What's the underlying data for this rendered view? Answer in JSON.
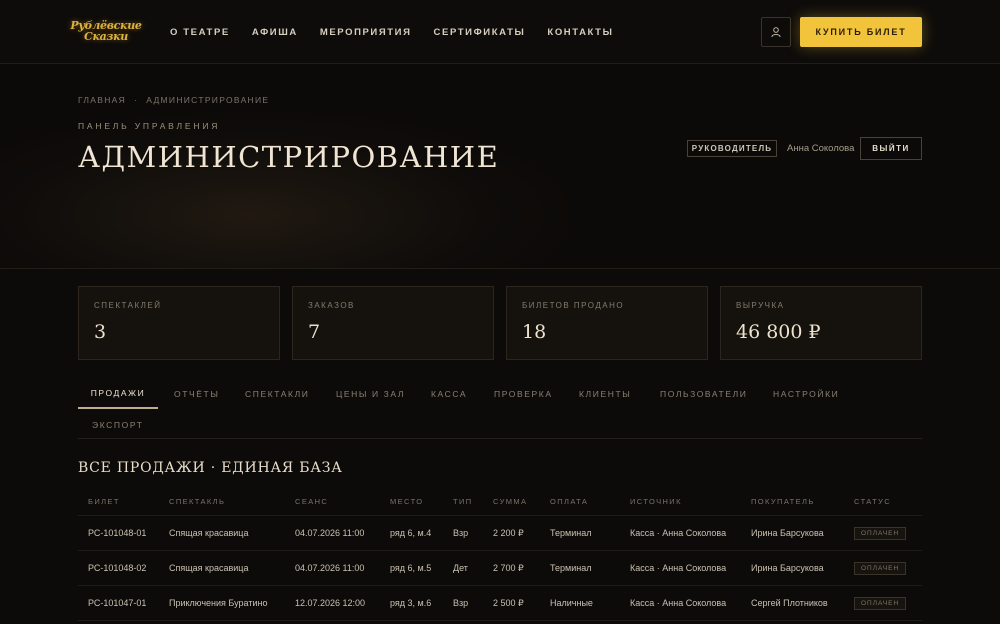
{
  "header": {
    "logo_line1": "Рублёвские",
    "logo_line2": "Сказки",
    "nav": [
      "О ТЕАТРЕ",
      "АФИША",
      "МЕРОПРИЯТИЯ",
      "СЕРТИФИКАТЫ",
      "КОНТАКТЫ"
    ],
    "buy_label": "КУПИТЬ БИЛЕТ"
  },
  "hero": {
    "breadcrumb": [
      "ГЛАВНАЯ",
      "·",
      "АДМИНИСТРИРОВАНИЕ"
    ],
    "eyebrow": "ПАНЕЛЬ УПРАВЛЕНИЯ",
    "title": "АДМИНИСТРИРОВАНИЕ",
    "role": "РУКОВОДИТЕЛЬ",
    "user_name": "Анна Соколова",
    "logout_label": "ВЫЙТИ"
  },
  "stats": [
    {
      "label": "СПЕКТАКЛЕЙ",
      "value": "3"
    },
    {
      "label": "ЗАКАЗОВ",
      "value": "7"
    },
    {
      "label": "БИЛЕТОВ ПРОДАНО",
      "value": "18"
    },
    {
      "label": "ВЫРУЧКА",
      "value": "46 800 ₽"
    }
  ],
  "tabs": [
    "ПРОДАЖИ",
    "ОТЧЁТЫ",
    "СПЕКТАКЛИ",
    "ЦЕНЫ И ЗАЛ",
    "КАССА",
    "ПРОВЕРКА",
    "КЛИЕНТЫ",
    "ПОЛЬЗОВАТЕЛИ",
    "НАСТРОЙКИ",
    "ЭКСПОРТ"
  ],
  "sales": {
    "title": "ВСЕ ПРОДАЖИ · ЕДИНАЯ БАЗА",
    "columns": [
      "БИЛЕТ",
      "СПЕКТАКЛЬ",
      "СЕАНС",
      "МЕСТО",
      "ТИП",
      "СУММА",
      "ОПЛАТА",
      "ИСТОЧНИК",
      "ПОКУПАТЕЛЬ",
      "СТАТУС"
    ],
    "rows": [
      [
        "РС-101048-01",
        "Спящая красавица",
        "04.07.2026 11:00",
        "ряд 6, м.4",
        "Взр",
        "2 200 ₽",
        "Терминал",
        "Касса · Анна Соколова",
        "Ирина Барсукова",
        "ОПЛАЧЕН"
      ],
      [
        "РС-101048-02",
        "Спящая красавица",
        "04.07.2026 11:00",
        "ряд 6, м.5",
        "Дет",
        "2 700 ₽",
        "Терминал",
        "Касса · Анна Соколова",
        "Ирина Барсукова",
        "ОПЛАЧЕН"
      ],
      [
        "РС-101047-01",
        "Приключения Буратино",
        "12.07.2026 12:00",
        "ряд 3, м.6",
        "Взр",
        "2 500 ₽",
        "Наличные",
        "Касса · Анна Соколова",
        "Сергей Плотников",
        "ОПЛАЧЕН"
      ]
    ]
  },
  "colors": {
    "accent": "#f2c43b",
    "background": "#0d0b09",
    "card": "#15110d"
  }
}
